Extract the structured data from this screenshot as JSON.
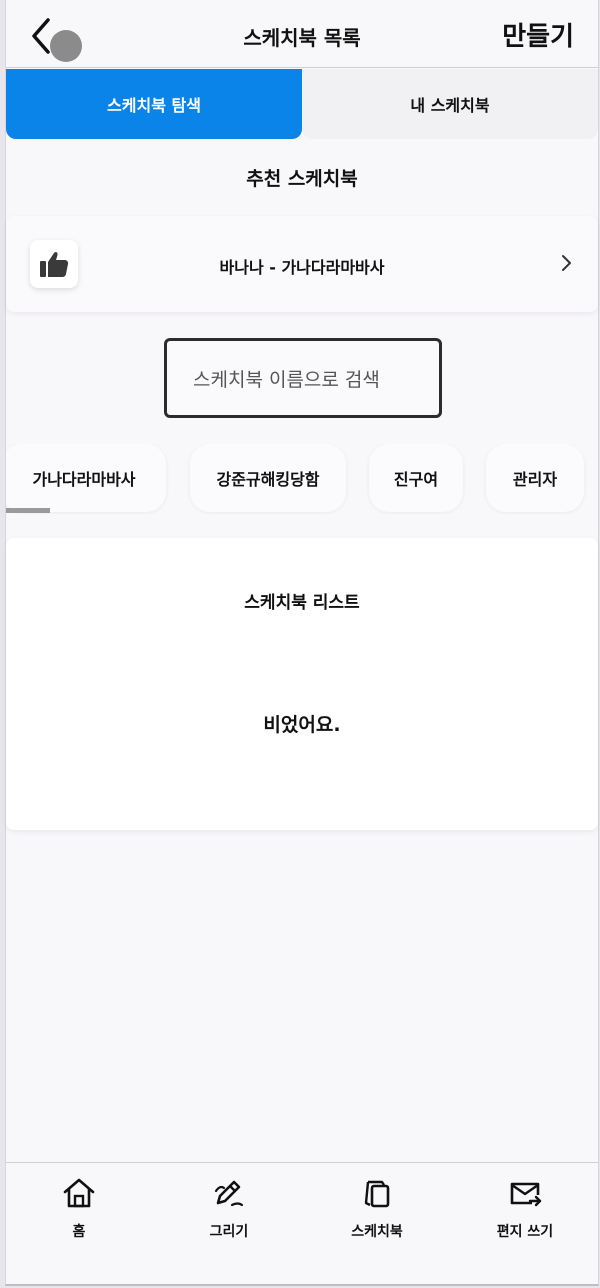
{
  "header": {
    "title": "스케치북 목록",
    "create_label": "만들기"
  },
  "tabs": [
    {
      "label": "스케치북 탐색",
      "active": true
    },
    {
      "label": "내 스케치북",
      "active": false
    }
  ],
  "recommended": {
    "heading": "추천 스케치북",
    "item_label": "바나나 - 가나다라마바사",
    "icon": "thumbs-up-icon"
  },
  "search": {
    "placeholder": "스케치북 이름으로 검색"
  },
  "chips": [
    {
      "label": "가나다라마바사"
    },
    {
      "label": "강준규해킹당함"
    },
    {
      "label": "진구여"
    },
    {
      "label": "관리자"
    }
  ],
  "list": {
    "title": "스케치북 리스트",
    "empty_text": "비었어요."
  },
  "bottom_nav": [
    {
      "label": "홈",
      "icon": "home-icon"
    },
    {
      "label": "그리기",
      "icon": "pencil-icon"
    },
    {
      "label": "스케치북",
      "icon": "sketchbook-icon"
    },
    {
      "label": "편지 쓰기",
      "icon": "mail-send-icon"
    }
  ],
  "colors": {
    "accent": "#0a84e8",
    "background": "#f8f7fa"
  }
}
